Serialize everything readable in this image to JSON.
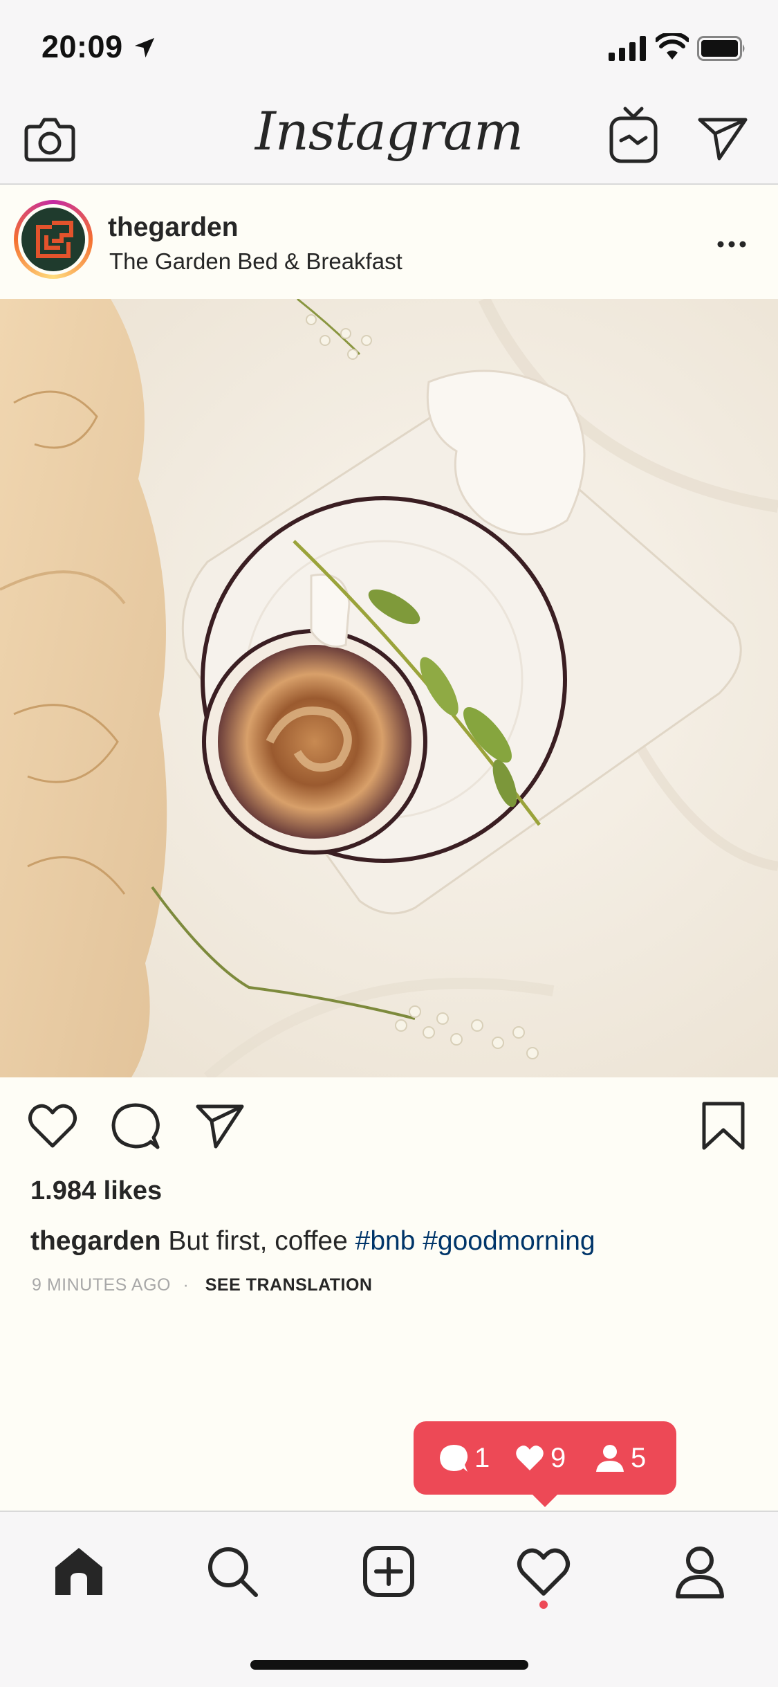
{
  "status_bar": {
    "time": "20:09"
  },
  "top_nav": {
    "logo_text": "Instagram"
  },
  "post": {
    "username": "thegarden",
    "location": "The Garden Bed & Breakfast",
    "likes": "1.984 likes",
    "caption": {
      "user": "thegarden",
      "text": "But first, coffee",
      "hashtags": [
        "#bnb",
        "#goodmorning"
      ]
    },
    "time_ago": "9 MINUTES AGO",
    "separator": "·",
    "see_translation": "SEE TRANSLATION"
  },
  "notification": {
    "comments": "1",
    "likes": "9",
    "follows": "5"
  },
  "colors": {
    "notification": "#ed4956",
    "hashtag": "#003569",
    "background": "#fefdf6"
  },
  "icons": [
    "camera-icon",
    "igtv-icon",
    "direct-icon",
    "more-icon",
    "heart-icon",
    "comment-icon",
    "share-icon",
    "bookmark-icon",
    "home-icon",
    "search-icon",
    "add-icon",
    "activity-icon",
    "profile-icon"
  ]
}
